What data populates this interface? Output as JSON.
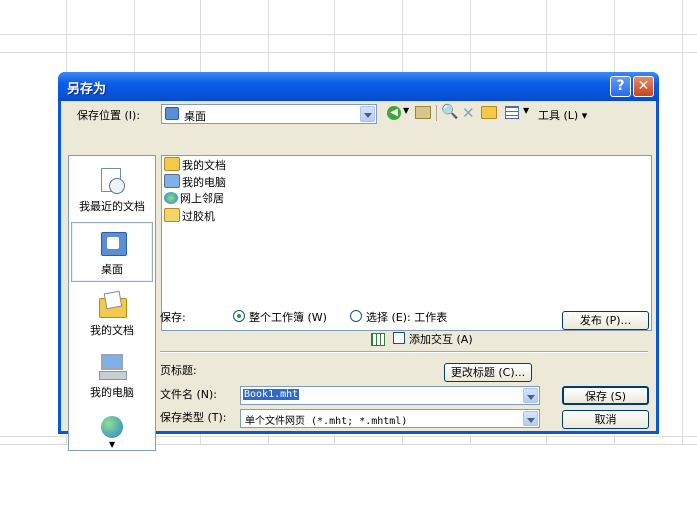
{
  "dialog": {
    "title": "另存为",
    "help_glyph": "?",
    "close_glyph": "✕"
  },
  "toolbar": {
    "save_in_label": "保存位置 (I):",
    "location_value": "桌面",
    "tools_label": "工具 (L) ▾"
  },
  "places": [
    {
      "label": "我最近的文档",
      "icon": "recent-documents-icon"
    },
    {
      "label": "桌面",
      "icon": "desktop-icon"
    },
    {
      "label": "我的文档",
      "icon": "my-documents-icon"
    },
    {
      "label": "我的电脑",
      "icon": "my-computer-icon"
    },
    {
      "label": "",
      "icon": "network-places-icon"
    }
  ],
  "files": [
    {
      "name": "我的文档",
      "icon": "my-documents-icon"
    },
    {
      "name": "我的电脑",
      "icon": "my-computer-icon"
    },
    {
      "name": "网上邻居",
      "icon": "network-places-icon"
    },
    {
      "name": "过胶机",
      "icon": "folder-icon"
    }
  ],
  "save_options": {
    "save_label": "保存:",
    "whole_workbook": "整个工作簿 (W)",
    "selection": "选择 (E): 工作表",
    "add_interactivity": "添加交互 (A)",
    "publish_button": "发布 (P)..."
  },
  "page_title": {
    "label": "页标题:",
    "change_button": "更改标题 (C)..."
  },
  "file_name": {
    "label": "文件名 (N):",
    "value": "Book1.mht"
  },
  "file_type": {
    "label": "保存类型 (T):",
    "value": "单个文件网页 (*.mht; *.mhtml)"
  },
  "buttons": {
    "save": "保存 (S)",
    "cancel": "取消"
  }
}
